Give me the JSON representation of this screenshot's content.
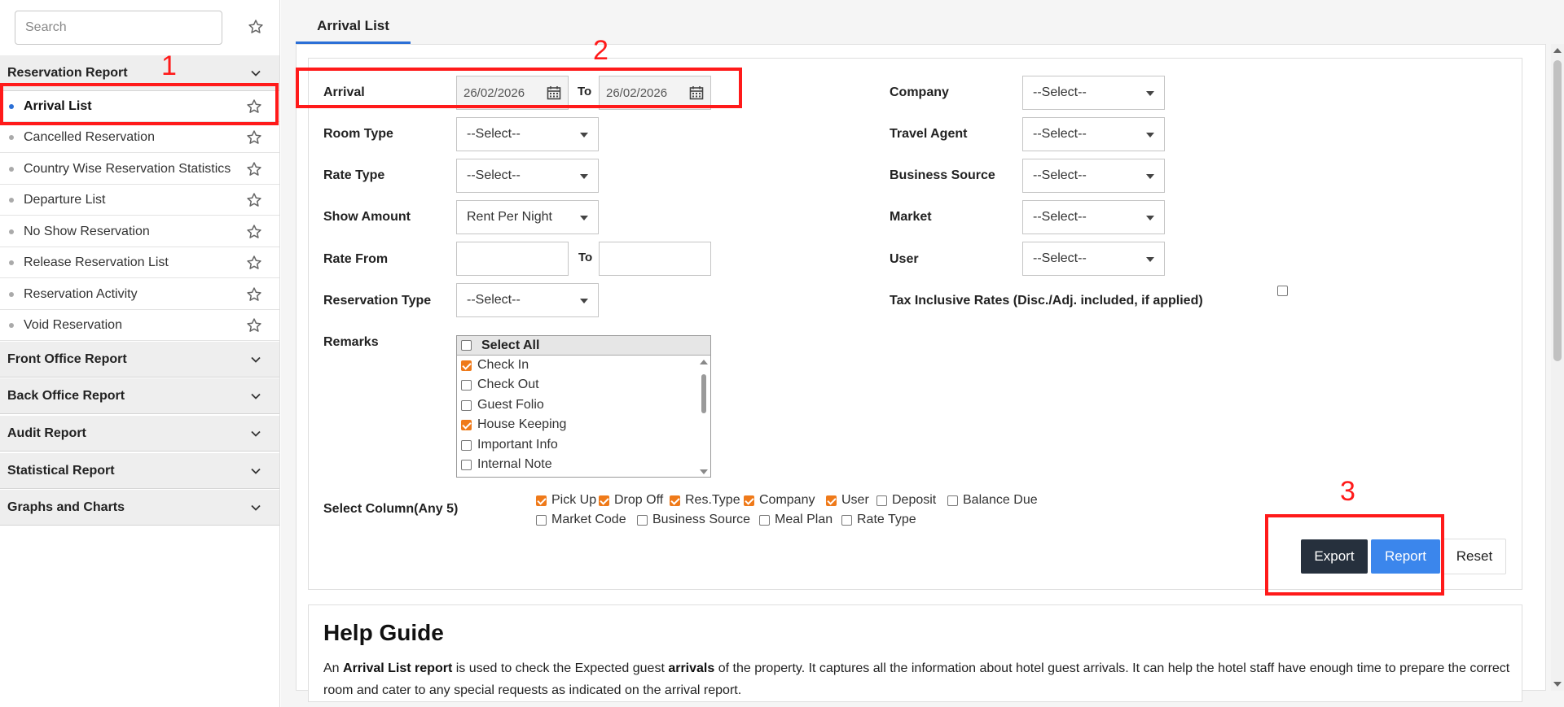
{
  "sidebar": {
    "search_placeholder": "Search",
    "reservation_report": {
      "title": "Reservation Report",
      "items": [
        {
          "label": "Arrival List",
          "active": true
        },
        {
          "label": "Cancelled Reservation"
        },
        {
          "label": "Country Wise Reservation Statistics"
        },
        {
          "label": "Departure List"
        },
        {
          "label": "No Show Reservation"
        },
        {
          "label": "Release Reservation List"
        },
        {
          "label": "Reservation Activity"
        },
        {
          "label": "Void Reservation"
        }
      ]
    },
    "sections": [
      "Front Office Report",
      "Back Office Report",
      "Audit Report",
      "Statistical Report",
      "Graphs and Charts"
    ]
  },
  "tab": {
    "label": "Arrival List"
  },
  "filters": {
    "arrival_label": "Arrival",
    "arrival_from": "26/02/2026",
    "to_label": "To",
    "arrival_to": "26/02/2026",
    "room_type_label": "Room Type",
    "room_type_value": "--Select--",
    "rate_type_label": "Rate Type",
    "rate_type_value": "--Select--",
    "show_amount_label": "Show Amount",
    "show_amount_value": "Rent Per Night",
    "rate_from_label": "Rate From",
    "rate_to_label": "To",
    "reservation_type_label": "Reservation Type",
    "reservation_type_value": "--Select--",
    "remarks_label": "Remarks",
    "company_label": "Company",
    "company_value": "--Select--",
    "travel_agent_label": "Travel Agent",
    "travel_agent_value": "--Select--",
    "business_source_label": "Business Source",
    "business_source_value": "--Select--",
    "market_label": "Market",
    "market_value": "--Select--",
    "user_label": "User",
    "user_value": "--Select--",
    "tax_inclusive_label": "Tax Inclusive Rates (Disc./Adj. included, if applied)"
  },
  "remarks": {
    "select_all": "Select All",
    "items": [
      {
        "label": "Check In",
        "checked": true
      },
      {
        "label": "Check Out",
        "checked": false
      },
      {
        "label": "Guest Folio",
        "checked": false
      },
      {
        "label": "House Keeping",
        "checked": true
      },
      {
        "label": "Important Info",
        "checked": false
      },
      {
        "label": "Internal Note",
        "checked": false
      }
    ]
  },
  "columns": {
    "label": "Select Column(Any 5)",
    "row1": [
      {
        "label": "Pick Up",
        "checked": true
      },
      {
        "label": "Drop Off",
        "checked": true
      },
      {
        "label": "Res.Type",
        "checked": true
      },
      {
        "label": "Company",
        "checked": true
      },
      {
        "label": "User",
        "checked": true
      },
      {
        "label": "Deposit",
        "checked": false
      },
      {
        "label": "Balance Due",
        "checked": false
      }
    ],
    "row2": [
      {
        "label": "Market Code",
        "checked": false
      },
      {
        "label": "Business Source",
        "checked": false
      },
      {
        "label": "Meal Plan",
        "checked": false
      },
      {
        "label": "Rate Type",
        "checked": false
      }
    ]
  },
  "buttons": {
    "export": "Export",
    "report": "Report",
    "reset": "Reset"
  },
  "help": {
    "title": "Help Guide",
    "t1": "An ",
    "b1": "Arrival List report",
    "t2": " is used to check the Expected guest ",
    "b2": "arrivals",
    "t3": " of the property. It captures all the information about hotel guest arrivals. It can help the hotel staff have enough time to prepare the correct room and cater to any special requests as indicated on the arrival report."
  },
  "annotations": {
    "n1": "1",
    "n2": "2",
    "n3": "3"
  },
  "colors": {
    "accent": "#2b6fd6",
    "check": "#ef7a1a",
    "annotation": "#ff1a1a",
    "export_btn": "#26303d"
  }
}
